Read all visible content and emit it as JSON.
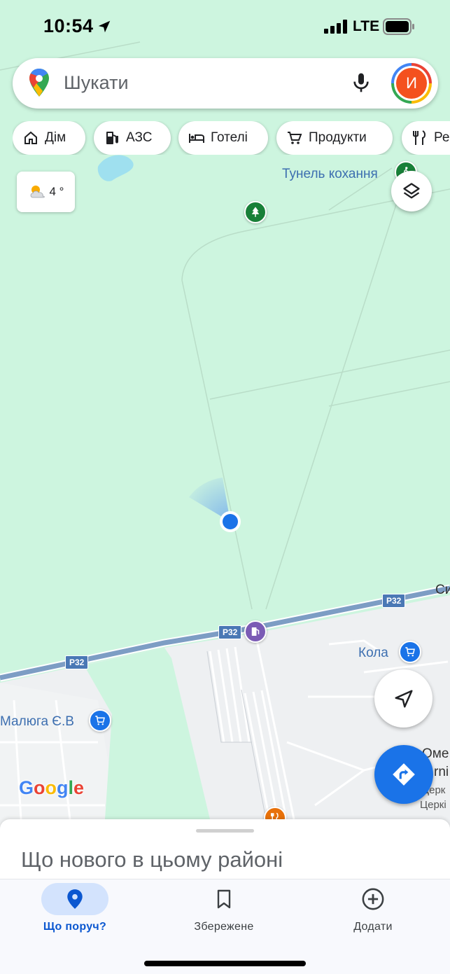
{
  "status_bar": {
    "time": "10:54",
    "network": "LTE"
  },
  "search": {
    "placeholder": "Шукати",
    "avatar_letter": "И"
  },
  "chips": [
    {
      "label": "Дім",
      "icon": "home-icon"
    },
    {
      "label": "АЗС",
      "icon": "gas-station-icon"
    },
    {
      "label": "Готелі",
      "icon": "hotel-bed-icon"
    },
    {
      "label": "Продукти",
      "icon": "shopping-cart-icon"
    },
    {
      "label": "Ре",
      "icon": "restaurant-icon"
    }
  ],
  "weather": {
    "temperature": "4 °",
    "icon": "partly-cloudy-icon"
  },
  "map": {
    "labels": {
      "tunnel": "Тунель кохання",
      "kola": "Кола",
      "maluha": "Малюга Є.В",
      "ome": "Оме",
      "rni": "rni",
      "tserk1": "Церк",
      "tserk2": "Церкі",
      "sy": "Си"
    },
    "road_shield": "Р32",
    "colors": {
      "forest": "#cdf5df",
      "urban": "#f1f3f4",
      "road": "#7d9dc4",
      "poi_shop": "#1a73e8",
      "poi_park": "#188038",
      "poi_food": "#e8710a"
    }
  },
  "google_logo": [
    "G",
    "o",
    "o",
    "g",
    "l",
    "e"
  ],
  "sheet": {
    "title": "Що нового в цьому районі"
  },
  "navbar": {
    "items": [
      {
        "label": "Що поруч?",
        "icon": "location-pin-icon",
        "active": true
      },
      {
        "label": "Збережене",
        "icon": "bookmark-icon",
        "active": false
      },
      {
        "label": "Додати",
        "icon": "add-circle-icon",
        "active": false
      }
    ]
  }
}
